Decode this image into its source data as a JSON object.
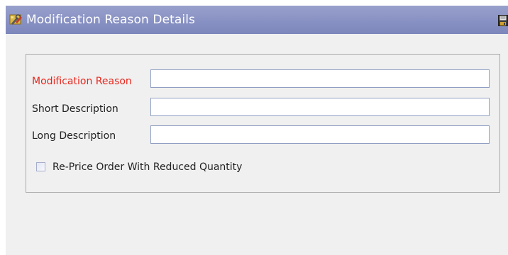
{
  "window": {
    "title": "Modification Reason Details",
    "title_icon": "wrench-tools-icon",
    "save_icon": "save-icon"
  },
  "form": {
    "fields": [
      {
        "label": "Modification Reason",
        "value": "",
        "required": true,
        "required_color": "#e8261c"
      },
      {
        "label": "Short Description",
        "value": "",
        "required": false
      },
      {
        "label": "Long Description",
        "value": "",
        "required": false
      }
    ],
    "checkbox": {
      "label": "Re-Price Order With Reduced Quantity",
      "checked": false
    }
  },
  "colors": {
    "titlebar": "#8891c3",
    "panel_background": "#f0f0f0",
    "input_border": "#8f9ec2"
  }
}
